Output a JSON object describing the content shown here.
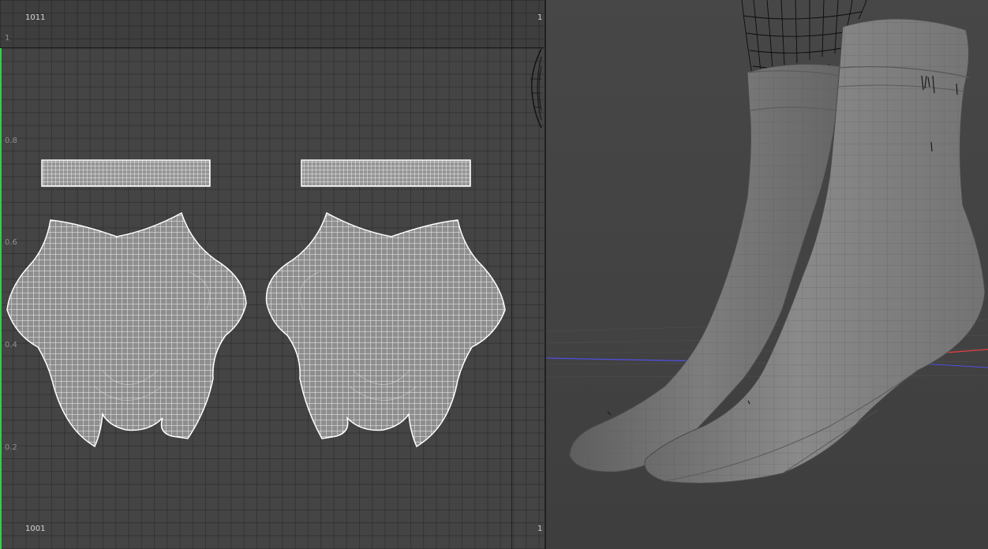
{
  "uv_editor": {
    "tile_labels": {
      "top_left": "1011",
      "bottom_left": "1001",
      "top_right": "1",
      "bottom_right": "1",
      "corner": "1"
    },
    "v_ticks": [
      "0.8",
      "0.6",
      "0.4",
      "0.2"
    ],
    "shells": [
      "cuff-strip-left",
      "cuff-strip-right",
      "sock-body-left",
      "sock-body-right"
    ],
    "colors": {
      "background": "#444444",
      "uv_wire": "#f0f0f0",
      "shell_fill": "#8f8f8f",
      "u_axis": "#2fd04a"
    }
  },
  "viewport": {
    "object": "sock-pair-model",
    "colors": {
      "background": "#444444",
      "x_axis": "#e04040",
      "z_axis": "#5050e0",
      "model": "#7c7c7c"
    }
  }
}
